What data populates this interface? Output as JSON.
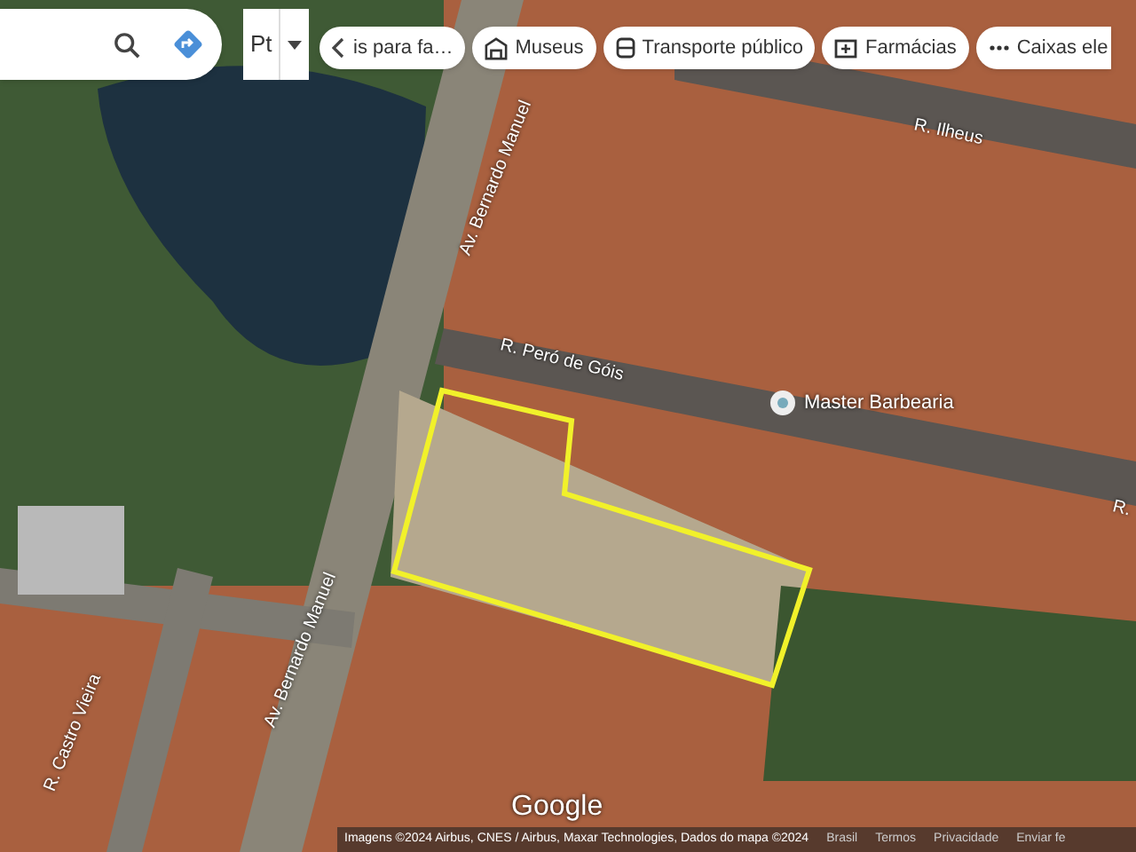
{
  "search": {
    "layers_button": {
      "label": "Pt"
    }
  },
  "chips": [
    {
      "label": "is para fa…",
      "kind": "back"
    },
    {
      "label": "Museus",
      "kind": "museum"
    },
    {
      "label": "Transporte público",
      "kind": "transit"
    },
    {
      "label": "Farmácias",
      "kind": "pharmacy"
    },
    {
      "label": "Caixas ele",
      "kind": "atm"
    }
  ],
  "map_labels": [
    {
      "text": "R. Ilheus",
      "kind": "street"
    },
    {
      "text": "Av. Bernardo Manuel",
      "kind": "street"
    },
    {
      "text": "R. Peró de Góis",
      "kind": "street"
    },
    {
      "text": "Master Barbearia",
      "kind": "place"
    },
    {
      "text": "R.",
      "kind": "street"
    },
    {
      "text": "R. Castro Vieira",
      "kind": "street"
    },
    {
      "text": "Av. Bernardo Manuel",
      "kind": "street"
    }
  ],
  "logo": "Google",
  "footer": {
    "attribution": "Imagens ©2024 Airbus, CNES / Airbus, Maxar Technologies, Dados do mapa ©2024",
    "links": [
      "Brasil",
      "Termos",
      "Privacidade",
      "Enviar fe"
    ]
  }
}
